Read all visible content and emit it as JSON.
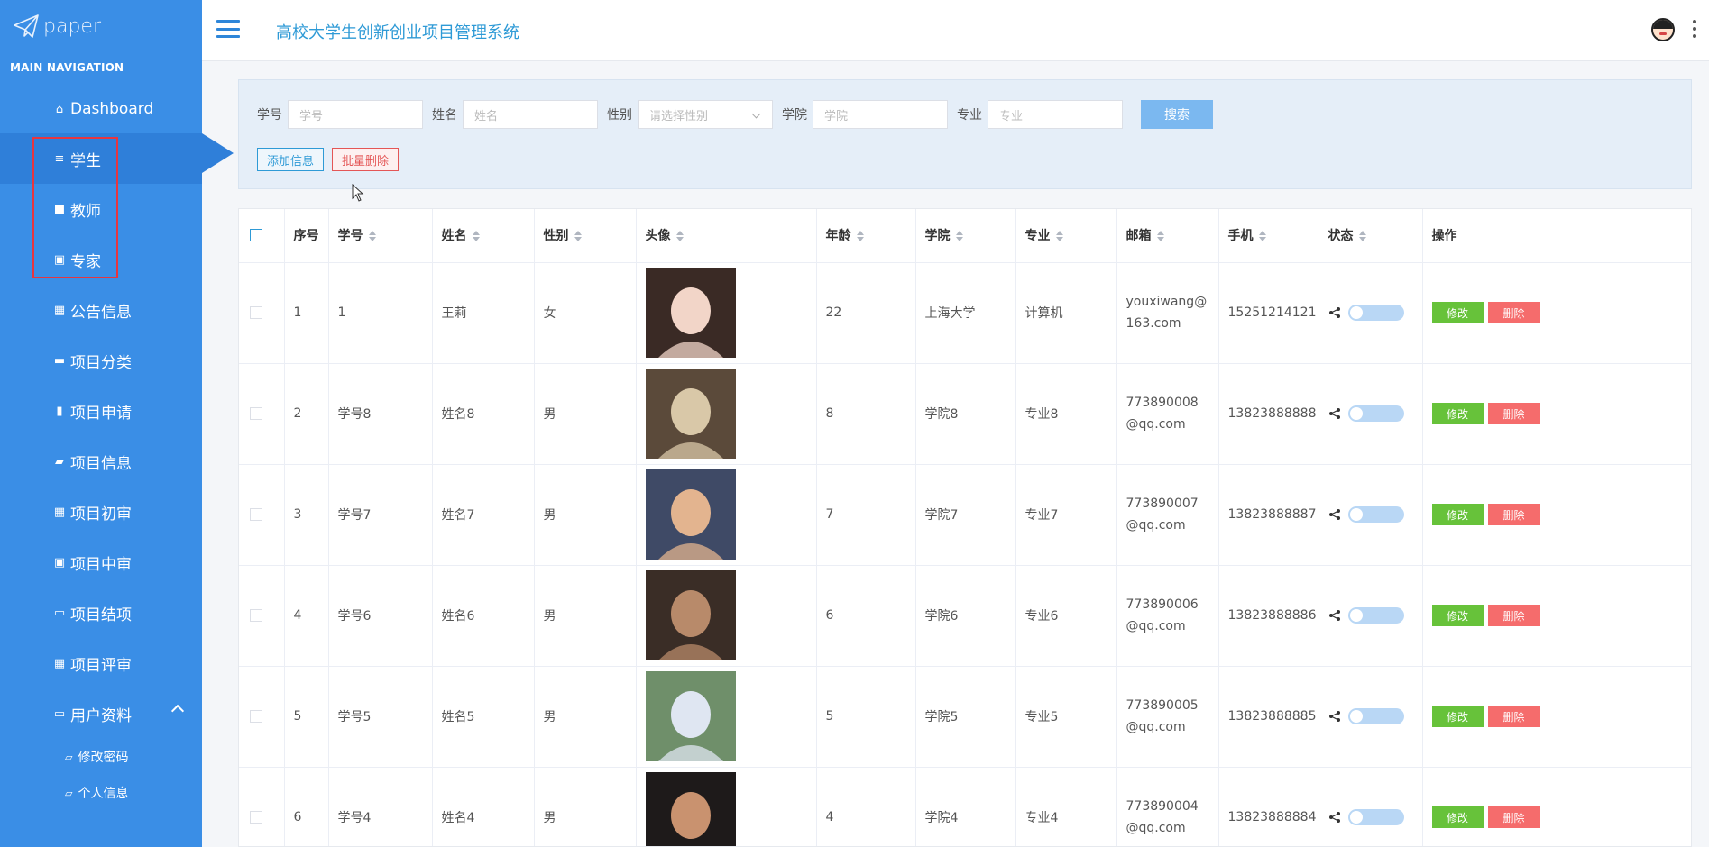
{
  "sidebar": {
    "logo_text": "paper",
    "nav_header": "MAIN NAVIGATION",
    "items": [
      {
        "label": "Dashboard",
        "icon": "home-icon"
      },
      {
        "label": "学生",
        "icon": "sliders-icon"
      },
      {
        "label": "教师",
        "icon": "briefcase-icon"
      },
      {
        "label": "专家",
        "icon": "clipboard-icon"
      },
      {
        "label": "公告信息",
        "icon": "grid-icon"
      },
      {
        "label": "项目分类",
        "icon": "comment-icon"
      },
      {
        "label": "项目申请",
        "icon": "bar-chart-icon"
      },
      {
        "label": "项目信息",
        "icon": "suitcase-icon"
      },
      {
        "label": "项目初审",
        "icon": "grid-icon"
      },
      {
        "label": "项目中审",
        "icon": "clipboard-icon"
      },
      {
        "label": "项目结项",
        "icon": "monitor-icon"
      },
      {
        "label": "项目评审",
        "icon": "grid-icon"
      },
      {
        "label": "用户资料",
        "icon": "card-icon"
      }
    ],
    "sub_items": [
      {
        "label": "修改密码",
        "icon": "folder-icon"
      },
      {
        "label": "个人信息",
        "icon": "folder-icon"
      }
    ]
  },
  "header": {
    "title": "高校大学生创新创业项目管理系统"
  },
  "search": {
    "fields": [
      {
        "label": "学号",
        "placeholder": "学号"
      },
      {
        "label": "姓名",
        "placeholder": "姓名"
      },
      {
        "label": "性别",
        "placeholder": "请选择性别"
      },
      {
        "label": "学院",
        "placeholder": "学院"
      },
      {
        "label": "专业",
        "placeholder": "专业"
      }
    ],
    "search_button": "搜索",
    "add_button": "添加信息",
    "batch_delete_button": "批量删除"
  },
  "table": {
    "columns": [
      "序号",
      "学号",
      "姓名",
      "性别",
      "头像",
      "年龄",
      "学院",
      "专业",
      "邮箱",
      "手机",
      "状态",
      "操作"
    ],
    "edit_label": "修改",
    "delete_label": "删除",
    "rows": [
      {
        "index": "1",
        "student_id": "1",
        "name": "王莉",
        "gender": "女",
        "age": "22",
        "college": "上海大学",
        "major": "计算机",
        "email": "youxiwang@163.com",
        "phone": "15251214121",
        "photo_colors": [
          "#3a2a25",
          "#f2d5c8"
        ]
      },
      {
        "index": "2",
        "student_id": "学号8",
        "name": "姓名8",
        "gender": "男",
        "age": "8",
        "college": "学院8",
        "major": "专业8",
        "email": "773890008@qq.com",
        "phone": "13823888888",
        "photo_colors": [
          "#5b4a3a",
          "#d9c8a8"
        ]
      },
      {
        "index": "3",
        "student_id": "学号7",
        "name": "姓名7",
        "gender": "男",
        "age": "7",
        "college": "学院7",
        "major": "专业7",
        "email": "773890007@qq.com",
        "phone": "13823888887",
        "photo_colors": [
          "#3f4a66",
          "#e3b48f"
        ]
      },
      {
        "index": "4",
        "student_id": "学号6",
        "name": "姓名6",
        "gender": "男",
        "age": "6",
        "college": "学院6",
        "major": "专业6",
        "email": "773890006@qq.com",
        "phone": "13823888886",
        "photo_colors": [
          "#3a2d26",
          "#b88a6a"
        ]
      },
      {
        "index": "5",
        "student_id": "学号5",
        "name": "姓名5",
        "gender": "男",
        "age": "5",
        "college": "学院5",
        "major": "专业5",
        "email": "773890005@qq.com",
        "phone": "13823888885",
        "photo_colors": [
          "#6f8f6a",
          "#dfe6f2"
        ]
      },
      {
        "index": "6",
        "student_id": "学号4",
        "name": "姓名4",
        "gender": "男",
        "age": "4",
        "college": "学院4",
        "major": "专业4",
        "email": "773890004@qq.com",
        "phone": "13823888884",
        "photo_colors": [
          "#1e1a1a",
          "#c9926f"
        ]
      }
    ]
  }
}
